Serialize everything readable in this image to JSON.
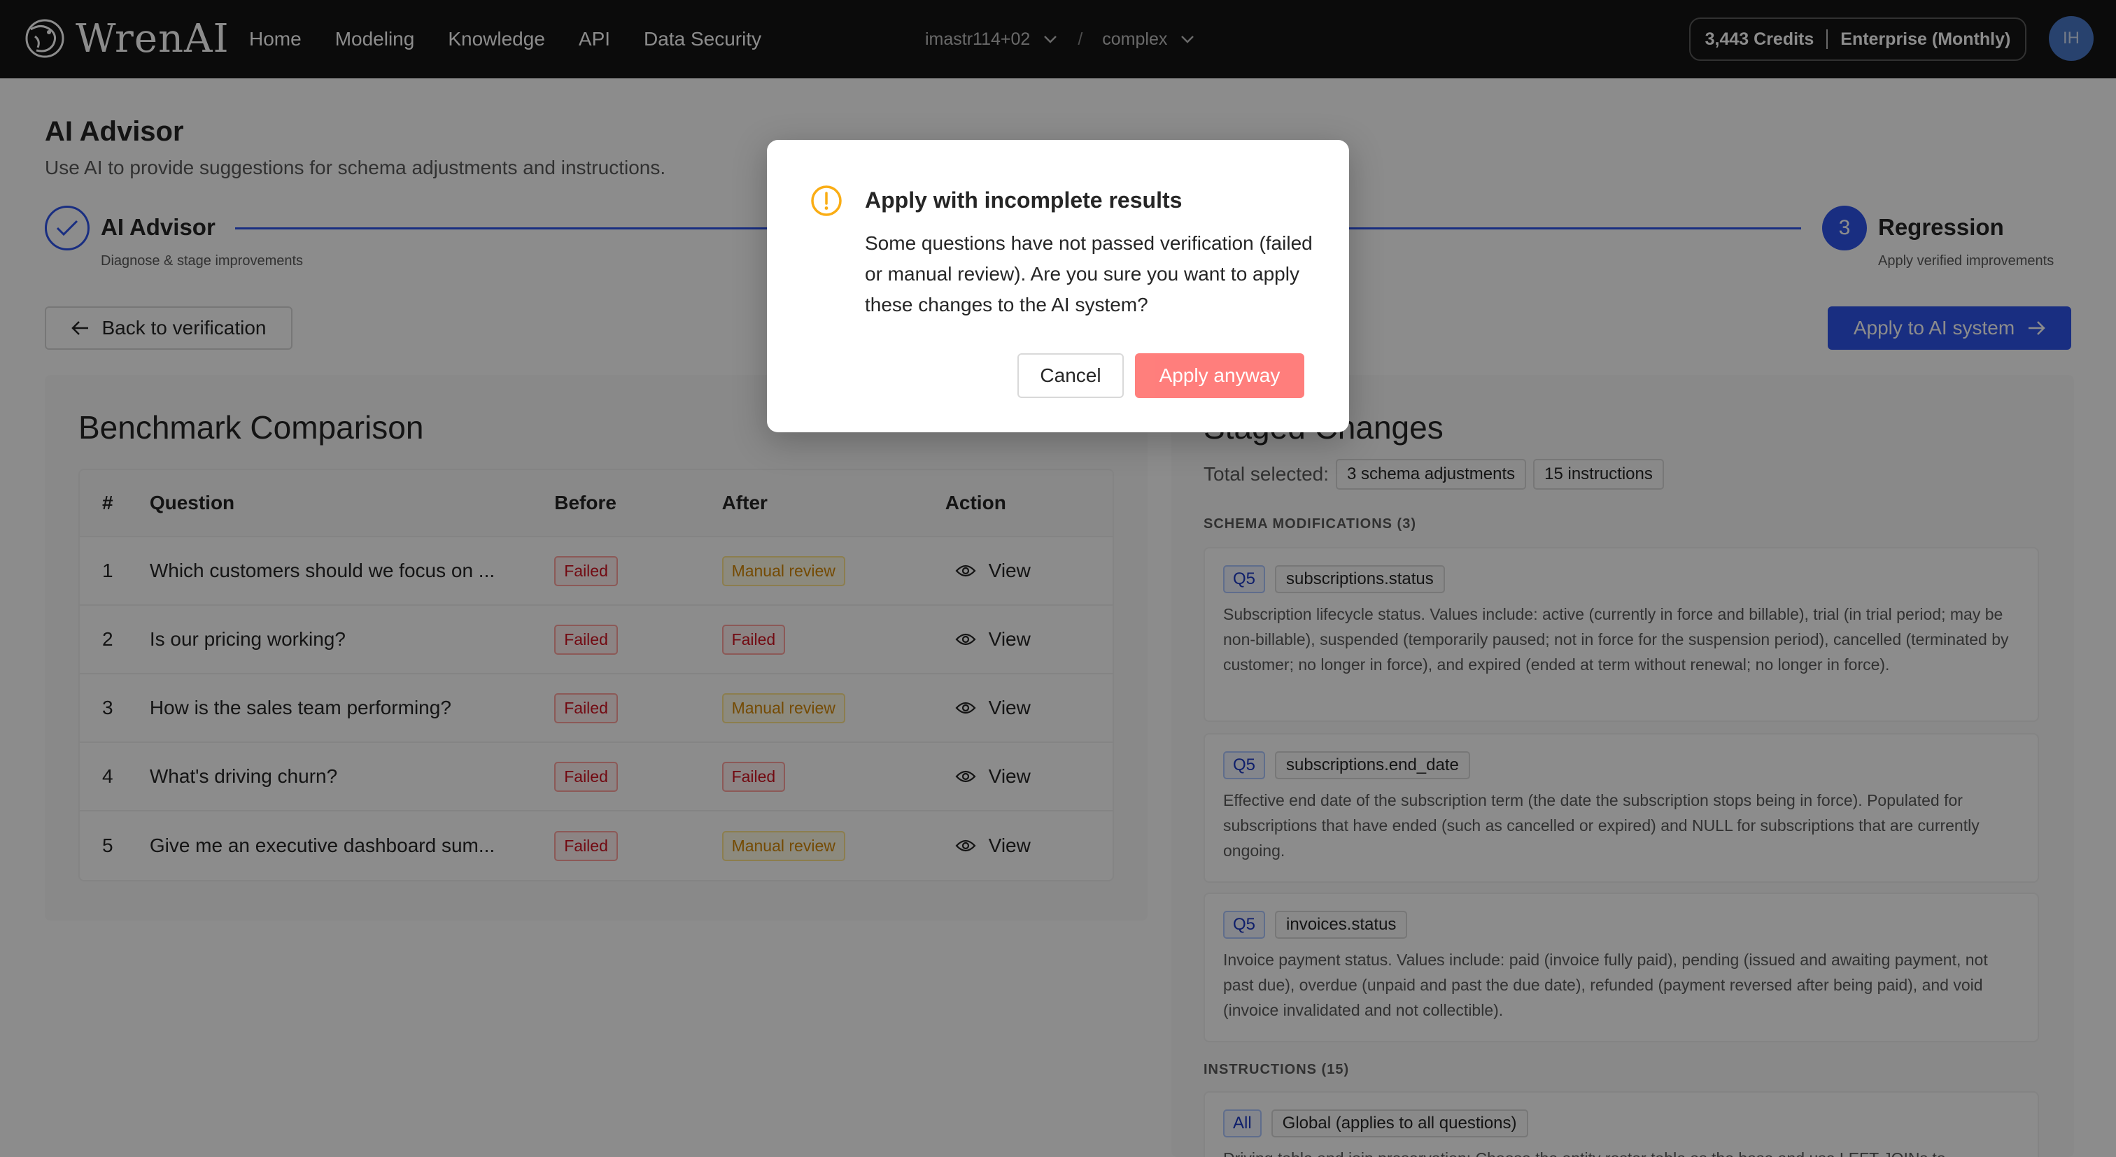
{
  "app": {
    "brand": "WrenAI",
    "nav": [
      "Home",
      "Modeling",
      "Knowledge",
      "API",
      "Data Security"
    ],
    "project": "imastr114+02",
    "context": "complex",
    "separator": "/",
    "credits": "3,443 Credits",
    "plan": "Enterprise (Monthly)",
    "avatar_initials": "IH"
  },
  "page": {
    "title": "AI Advisor",
    "subtitle": "Use AI to provide suggestions for schema adjustments and instructions."
  },
  "steps": {
    "step1": {
      "title": "AI Advisor",
      "desc": "Diagnose & stage improvements"
    },
    "step3": {
      "number": "3",
      "title": "Regression",
      "desc": "Apply verified improvements"
    }
  },
  "actions": {
    "back": "Back to verification",
    "apply": "Apply to AI system"
  },
  "benchmark": {
    "title": "Benchmark Comparison",
    "columns": [
      "#",
      "Question",
      "Before",
      "After",
      "Action"
    ],
    "rows": [
      {
        "num": "1",
        "question": "Which customers should we focus on ...",
        "before": "Failed",
        "after": "Manual review",
        "action": "View"
      },
      {
        "num": "2",
        "question": "Is our pricing working?",
        "before": "Failed",
        "after": "Failed",
        "action": "View"
      },
      {
        "num": "3",
        "question": "How is the sales team performing?",
        "before": "Failed",
        "after": "Manual review",
        "action": "View"
      },
      {
        "num": "4",
        "question": "What's driving churn?",
        "before": "Failed",
        "after": "Failed",
        "action": "View"
      },
      {
        "num": "5",
        "question": "Give me an executive dashboard sum...",
        "before": "Failed",
        "after": "Manual review",
        "action": "View"
      }
    ]
  },
  "staged": {
    "title": "Staged Changes",
    "total_label": "Total selected:",
    "schema_count": "3 schema adjustments",
    "instruction_count": "15 instructions",
    "schema_heading": "SCHEMA MODIFICATIONS (3)",
    "schema": [
      {
        "q": "Q5",
        "field": "subscriptions.status",
        "desc": "Subscription lifecycle status. Values include: active (currently in force and billable), trial (in trial period; may be non-billable), suspended (temporarily paused; not in force for the suspension period), cancelled (terminated by customer; no longer in force), and expired (ended at term without renewal; no longer in force)."
      },
      {
        "q": "Q5",
        "field": "subscriptions.end_date",
        "desc": "Effective end date of the subscription term (the date the subscription stops being in force). Populated for subscriptions that have ended (such as cancelled or expired) and NULL for subscriptions that are currently ongoing."
      },
      {
        "q": "Q5",
        "field": "invoices.status",
        "desc": "Invoice payment status. Values include: paid (invoice fully paid), pending (issued and awaiting payment, not past due), overdue (unpaid and past the due date), refunded (payment reversed after being paid), and void (invoice invalidated and not collectible)."
      }
    ],
    "instructions_heading": "INSTRUCTIONS (15)",
    "instruction": {
      "scope": "All",
      "label": "Global (applies to all questions)",
      "desc": "Driving table and join preservation: Choose the entity roster table as the base and use LEFT JOINs to"
    }
  },
  "modal": {
    "title": "Apply with incomplete results",
    "body": "Some questions have not passed verification (failed or manual review). Are you sure you want to apply these changes to the AI system?",
    "cancel": "Cancel",
    "confirm": "Apply anyway"
  },
  "colors": {
    "primary": "#2f54eb",
    "danger_light": "#ff7875",
    "warning": "#faad14",
    "topbar": "#141414"
  }
}
